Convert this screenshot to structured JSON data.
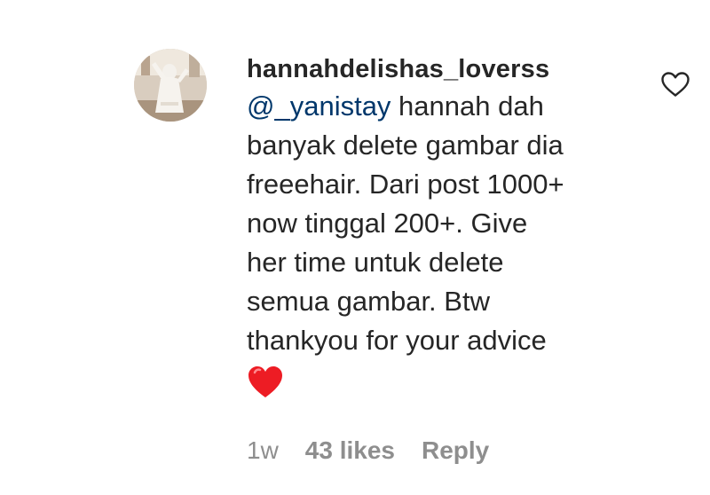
{
  "comment": {
    "username": "hannahdelishas_loverss",
    "mention": "@_yanistay",
    "text_lines": [
      " hannah dah",
      "banyak delete gambar dia",
      "freeehair. Dari post 1000+",
      "now tinggal 200+. Give",
      "her time untuk delete",
      "semua gambar. Btw",
      "thankyou for your advice"
    ],
    "emoji": "red-heart-emoji",
    "time": "1w",
    "likes": "43 likes",
    "reply_label": "Reply",
    "like_icon": "heart-outline-icon"
  },
  "colors": {
    "text": "#262626",
    "mention": "#00376b",
    "meta": "#8e8e8e",
    "heart": "#ed1c24"
  }
}
